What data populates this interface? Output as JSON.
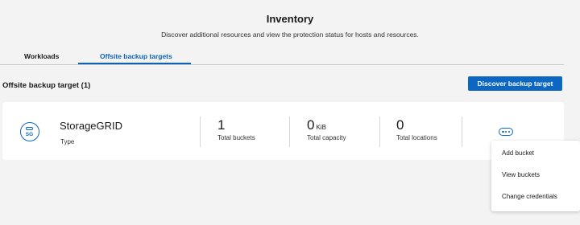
{
  "header": {
    "title": "Inventory",
    "subtitle": "Discover additional resources and view the protection status for hosts and resources."
  },
  "tabs": [
    {
      "label": "Workloads",
      "active": false
    },
    {
      "label": "Offsite backup targets",
      "active": true
    }
  ],
  "section": {
    "title": "Offsite backup target (1)",
    "discover_button": "Discover backup target"
  },
  "target": {
    "icon_text": "SG",
    "icon": "storagegrid-icon",
    "name": "StorageGRID",
    "type_label": "Type",
    "stats": [
      {
        "value": "1",
        "unit": "",
        "label": "Total buckets"
      },
      {
        "value": "0",
        "unit": "KiB",
        "label": "Total capacity"
      },
      {
        "value": "0",
        "unit": "",
        "label": "Total locations"
      }
    ]
  },
  "actions_menu": {
    "items": [
      "Add bucket",
      "View buckets",
      "Change credentials"
    ]
  },
  "colors": {
    "accent": "#0b67c2",
    "page_background": "#f3f3f3",
    "card_background": "#ffffff"
  }
}
